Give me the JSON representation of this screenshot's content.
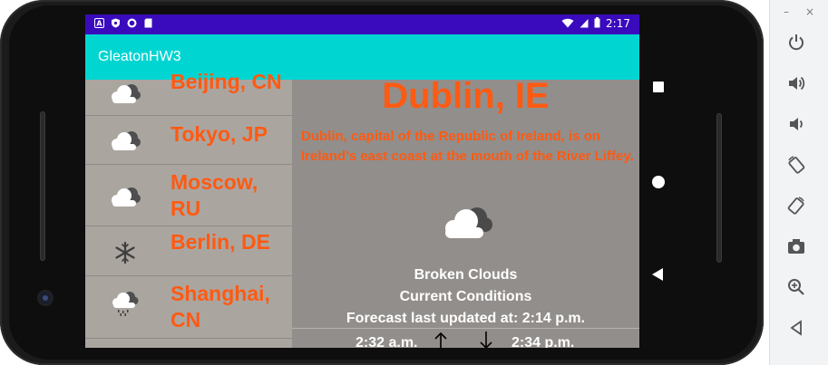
{
  "window_controls": {
    "minimize": "–",
    "close": "×"
  },
  "status_bar": {
    "time": "2:17",
    "left_icons": [
      "notification-a-icon",
      "shield-icon",
      "record-icon",
      "sd-card-icon"
    ],
    "right_icons": [
      "wifi-icon",
      "signal-icon",
      "battery-icon"
    ]
  },
  "app_bar": {
    "title": "GleatonHW3"
  },
  "city_list": {
    "items": [
      {
        "name": "Beijing, CN",
        "icon": "cloud-icon"
      },
      {
        "name": "Tokyo, JP",
        "icon": "cloud-icon"
      },
      {
        "name": "Moscow, RU",
        "icon": "cloud-icon"
      },
      {
        "name": "Berlin, DE",
        "icon": "snowflake-icon"
      },
      {
        "name": "Shanghai, CN",
        "icon": "rain-cloud-icon"
      }
    ]
  },
  "detail": {
    "title": "Dublin, IE",
    "description": "Dublin, capital of the Republic of Ireland, is on Ireland’s east coast at the mouth of the River Liffey.",
    "condition_icon": "broken-clouds-icon",
    "condition": "Broken Clouds",
    "conditions_label": "Current Conditions",
    "updated": "Forecast last updated at: 2:14 p.m.",
    "sunrise": "2:32 a.m.",
    "sunset": "2:34 p.m."
  },
  "emulator_toolbar": [
    "power-icon",
    "volume-up-icon",
    "volume-down-icon",
    "rotate-left-icon",
    "rotate-right-icon",
    "camera-icon",
    "zoom-icon",
    "back-icon"
  ],
  "colors": {
    "status_bar": "#3a0bbd",
    "app_bar": "#00d5d2",
    "city_text": "#ff5a12",
    "list_bg": "#aba5a0",
    "detail_bg": "#928e8b"
  }
}
